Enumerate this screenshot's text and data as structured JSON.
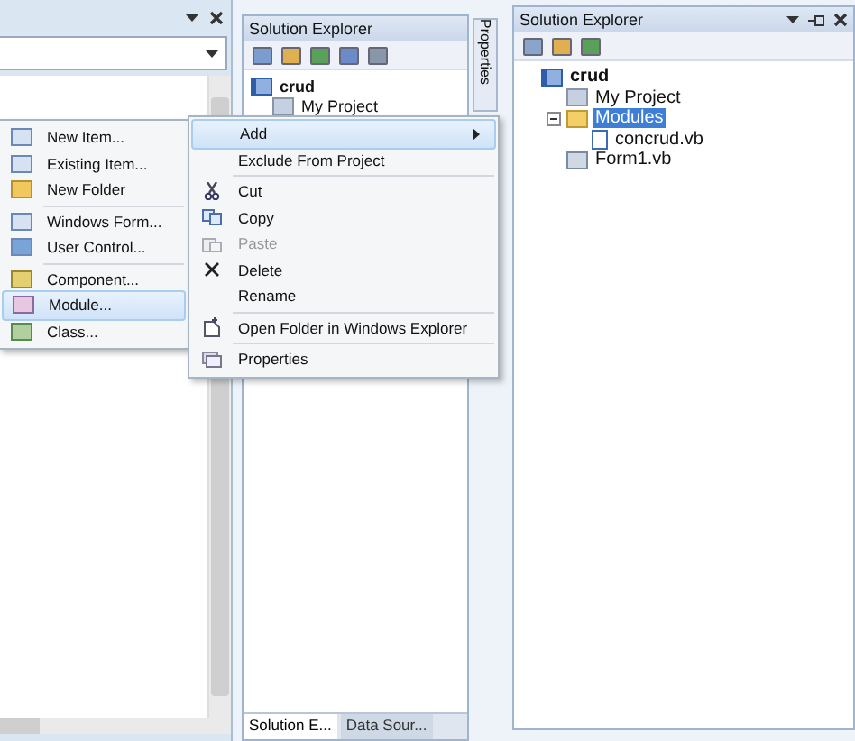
{
  "middle_explorer": {
    "title": "Solution Explorer",
    "tree": [
      {
        "label": "crud",
        "kind": "project",
        "children": [
          {
            "label": "My Project",
            "kind": "myproject"
          }
        ]
      }
    ],
    "bottom_tabs": [
      {
        "label": "Solution E...",
        "selected": true
      },
      {
        "label": "Data Sour...",
        "selected": false
      }
    ]
  },
  "properties_tab": {
    "label": "Properties"
  },
  "right_explorer": {
    "title": "Solution Explorer",
    "tree": [
      {
        "label": "crud",
        "kind": "project",
        "selected": false,
        "children": [
          {
            "label": "My Project",
            "kind": "myproject",
            "selected": false
          },
          {
            "label": "Modules",
            "kind": "folder",
            "selected": true,
            "expanded": true,
            "children": [
              {
                "label": "concrud.vb",
                "kind": "module",
                "selected": false
              }
            ]
          },
          {
            "label": "Form1.vb",
            "kind": "form",
            "selected": false
          }
        ]
      }
    ]
  },
  "add_submenu": {
    "items": [
      {
        "kind": "item",
        "label": "New Item...",
        "selected": false
      },
      {
        "kind": "item",
        "label": "Existing Item...",
        "selected": false
      },
      {
        "kind": "item",
        "label": "New Folder",
        "selected": false
      },
      {
        "kind": "separator"
      },
      {
        "kind": "item",
        "label": "Windows Form...",
        "selected": false
      },
      {
        "kind": "item",
        "label": "User Control...",
        "selected": false
      },
      {
        "kind": "separator"
      },
      {
        "kind": "item",
        "label": "Component...",
        "selected": false
      },
      {
        "kind": "item",
        "label": "Module...",
        "selected": true
      },
      {
        "kind": "item",
        "label": "Class...",
        "selected": false
      }
    ]
  },
  "context_menu": {
    "items": [
      {
        "kind": "item",
        "label": "Add",
        "selected": true,
        "disabled": false,
        "submenu": true
      },
      {
        "kind": "item",
        "label": "Exclude From Project",
        "selected": false,
        "disabled": false,
        "submenu": false
      },
      {
        "kind": "separator"
      },
      {
        "kind": "item",
        "label": "Cut",
        "selected": false,
        "disabled": false,
        "submenu": false
      },
      {
        "kind": "item",
        "label": "Copy",
        "selected": false,
        "disabled": false,
        "submenu": false
      },
      {
        "kind": "item",
        "label": "Paste",
        "selected": false,
        "disabled": true,
        "submenu": false
      },
      {
        "kind": "item",
        "label": "Delete",
        "selected": false,
        "disabled": false,
        "submenu": false
      },
      {
        "kind": "item",
        "label": "Rename",
        "selected": false,
        "disabled": false,
        "submenu": false
      },
      {
        "kind": "separator"
      },
      {
        "kind": "item",
        "label": "Open Folder in Windows Explorer",
        "selected": false,
        "disabled": false,
        "submenu": false
      },
      {
        "kind": "separator"
      },
      {
        "kind": "item",
        "label": "Properties",
        "selected": false,
        "disabled": false,
        "submenu": false
      }
    ]
  }
}
